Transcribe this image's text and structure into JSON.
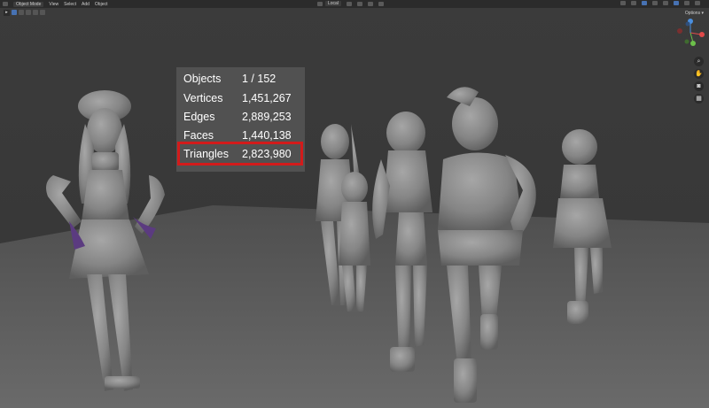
{
  "header": {
    "mode": "Object Mode",
    "menus": [
      "View",
      "Select",
      "Add",
      "Object"
    ],
    "transform_orientation": "Local"
  },
  "options_label": "Options",
  "stats": [
    {
      "label": "Objects",
      "value": "1 / 152"
    },
    {
      "label": "Vertices",
      "value": "1,451,267"
    },
    {
      "label": "Edges",
      "value": "2,889,253"
    },
    {
      "label": "Faces",
      "value": "1,440,138"
    },
    {
      "label": "Triangles",
      "value": "2,823,980"
    }
  ],
  "highlighted_stat": "Triangles",
  "colors": {
    "highlight": "#d21b1b",
    "accent": "#4772b3",
    "model": "#8a8a8a"
  }
}
